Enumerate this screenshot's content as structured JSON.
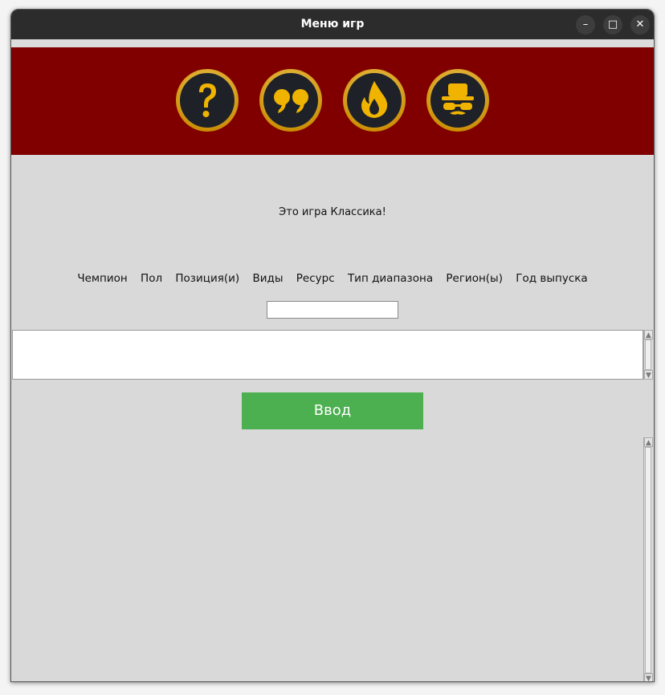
{
  "window": {
    "title": "Меню игр",
    "minimize_label": "–",
    "maximize_label": "□",
    "close_label": "✕"
  },
  "colors": {
    "titlebar": "#2c2c2c",
    "banner": "#800000",
    "icon_gold": "#e0a800",
    "icon_dark": "#1e2228",
    "enter_button": "#4caf50",
    "background": "#d9d9d9"
  },
  "modes": [
    {
      "icon": "question-mark-icon"
    },
    {
      "icon": "quote-icon"
    },
    {
      "icon": "flame-icon"
    },
    {
      "icon": "disguise-icon"
    }
  ],
  "game": {
    "mode_label": "Это игра Классика!",
    "columns": [
      "Чемпион",
      "Пол",
      "Позиция(и)",
      "Виды",
      "Ресурс",
      "Тип диапазона",
      "Регион(ы)",
      "Год выпуска"
    ],
    "input_value": "",
    "enter_label": "Ввод"
  }
}
